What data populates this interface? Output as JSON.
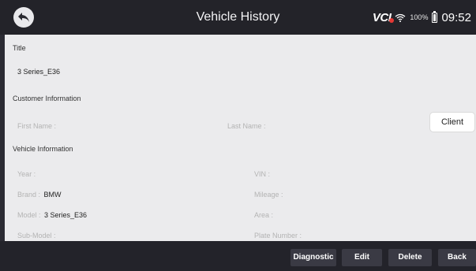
{
  "header": {
    "title": "Vehicle History",
    "status": {
      "vci_label": "VCI",
      "battery": "100%",
      "time": "09:52"
    },
    "icons": [
      "back-icon",
      "wifi-icon",
      "battery-icon"
    ]
  },
  "title_section": {
    "label": "Title",
    "value": "3 Series_E36"
  },
  "customer": {
    "label": "Customer Information",
    "first_name_label": "First Name :",
    "last_name_label": "Last Name :",
    "client_button": "Client"
  },
  "vehicle": {
    "label": "Vehicle Information",
    "year_label": "Year :",
    "vin_label": "VIN :",
    "brand_label": "Brand :",
    "brand_value": "BMW",
    "mileage_label": "Mileage :",
    "model_label": "Model :",
    "model_value": "3 Series_E36",
    "area_label": "Area :",
    "submodel_label": "Sub-Model :",
    "plate_label": "Plate Number :"
  },
  "footer": {
    "diagnostic": "Diagnostic",
    "edit": "Edit",
    "delete": "Delete",
    "back": "Back"
  }
}
